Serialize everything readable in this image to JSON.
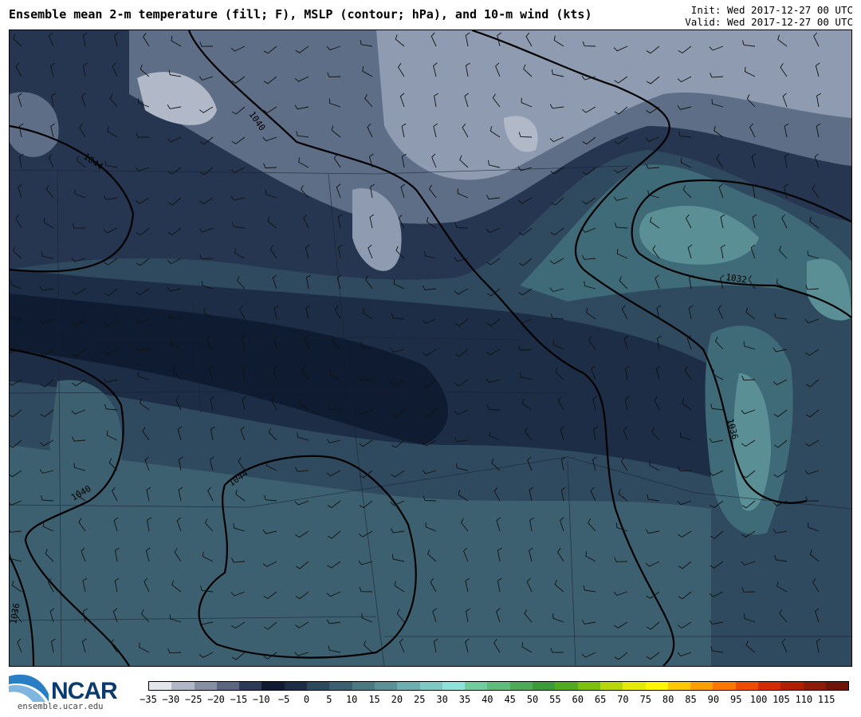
{
  "header": {
    "title": "Ensemble mean 2-m temperature (fill; F), MSLP (contour; hPa), and 10-m wind (kts)",
    "init": "Init: Wed 2017-12-27 00 UTC",
    "valid": "Valid: Wed 2017-12-27 00 UTC"
  },
  "map": {
    "contour_labels": [
      "1044",
      "1040",
      "1032",
      "1036",
      "1040",
      "1044",
      "1036"
    ],
    "colors": {
      "background": "#2f4a5e",
      "coldest": "#0f1b30",
      "cold": "#263650",
      "cool": "#5e6e86",
      "light": "#8f9bb0",
      "lighter": "#b1b9c9",
      "lake": "#3f6b78",
      "lake_light": "#5a8f95"
    }
  },
  "colorbar": {
    "labels": [
      "−35",
      "−30",
      "−25",
      "−20",
      "−15",
      "−10",
      "−5",
      "0",
      "5",
      "10",
      "15",
      "20",
      "25",
      "30",
      "35",
      "40",
      "45",
      "50",
      "55",
      "60",
      "65",
      "70",
      "75",
      "80",
      "85",
      "90",
      "95",
      "100",
      "105",
      "110",
      "115"
    ],
    "colors": [
      "#e2e5ea",
      "#b1b7c6",
      "#868fa3",
      "#5b6681",
      "#2c3a58",
      "#101a30",
      "#1c2d45",
      "#2c4a5c",
      "#3c6070",
      "#4c7882",
      "#5c9097",
      "#6daeb0",
      "#7ec8c6",
      "#8ee2da",
      "#72cc9e",
      "#5fbc7a",
      "#4caa58",
      "#3c9a38",
      "#52aa20",
      "#7ec010",
      "#b8d60a",
      "#e6ea08",
      "#fcf600",
      "#fcc800",
      "#fca000",
      "#fa7800",
      "#f04c00",
      "#d42c00",
      "#b02000",
      "#8e1a08",
      "#6e1408"
    ]
  },
  "logo": {
    "text": "NCAR",
    "url": "ensemble.ucar.edu"
  }
}
